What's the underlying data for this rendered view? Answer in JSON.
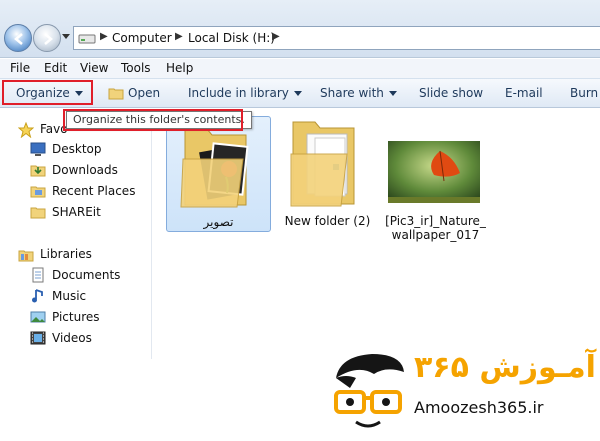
{
  "breadcrumb": {
    "items": [
      "Computer",
      "Local Disk (H:)"
    ]
  },
  "menu": {
    "items": [
      "File",
      "Edit",
      "View",
      "Tools",
      "Help"
    ]
  },
  "toolbar": {
    "organize": "Organize",
    "open": "Open",
    "include_in_library": "Include in library",
    "share_with": "Share with",
    "slide_show": "Slide show",
    "email": "E-mail",
    "burn": "Burn"
  },
  "tooltip": {
    "text": "Organize this folder's contents."
  },
  "nav": {
    "favorites_label": "Favo",
    "favorites": [
      "Desktop",
      "Downloads",
      "Recent Places",
      "SHAREit"
    ],
    "libraries_label": "Libraries",
    "libraries": [
      "Documents",
      "Music",
      "Pictures",
      "Videos"
    ]
  },
  "files": [
    {
      "name": "تصویر",
      "type": "folder-with-images",
      "selected": true
    },
    {
      "name": "New folder (2)",
      "type": "folder",
      "selected": false
    },
    {
      "name_line1": "[Pic3_ir]_Nature_",
      "name_line2": "wallpaper_017",
      "type": "image",
      "selected": false
    }
  ],
  "logo": {
    "fa_text": "آمـوزش ۳۶۵",
    "en_text": "Amoozesh365.ir"
  },
  "colors": {
    "highlight_red": "#e01f2a",
    "logo_orange": "#f5a300",
    "selection_blue": "#cde3f9"
  }
}
